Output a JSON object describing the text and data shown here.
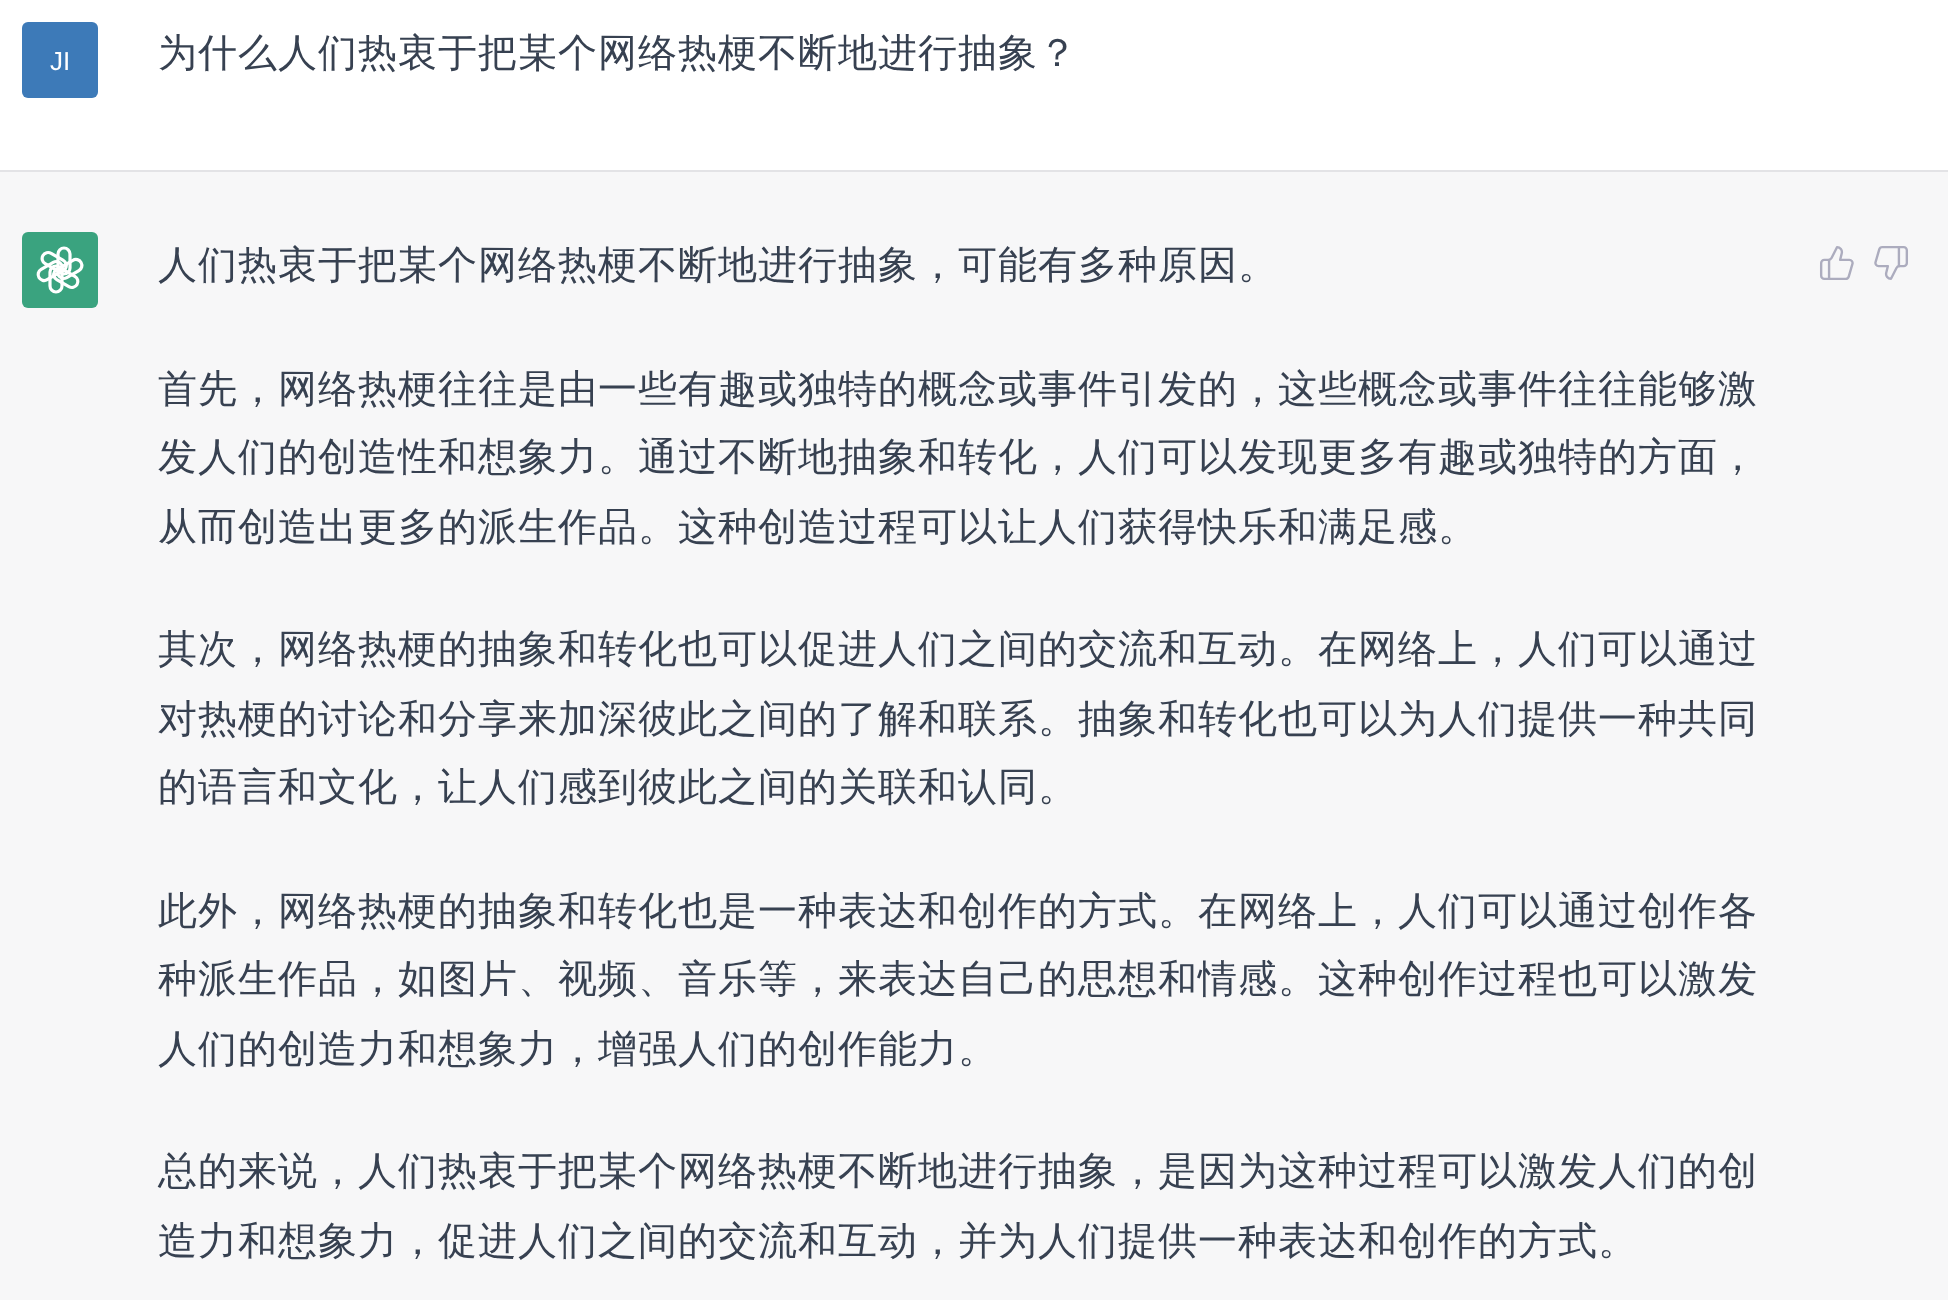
{
  "messages": [
    {
      "kind": "user",
      "avatar": "JI",
      "paragraphs": [
        "为什么人们热衷于把某个网络热梗不断地进行抽象？"
      ]
    },
    {
      "kind": "assistant",
      "paragraphs": [
        "人们热衷于把某个网络热梗不断地进行抽象，可能有多种原因。",
        "首先，网络热梗往往是由一些有趣或独特的概念或事件引发的，这些概念或事件往往能够激发人们的创造性和想象力。通过不断地抽象和转化，人们可以发现更多有趣或独特的方面，从而创造出更多的派生作品。这种创造过程可以让人们获得快乐和满足感。",
        "其次，网络热梗的抽象和转化也可以促进人们之间的交流和互动。在网络上，人们可以通过对热梗的讨论和分享来加深彼此之间的了解和联系。抽象和转化也可以为人们提供一种共同的语言和文化，让人们感到彼此之间的关联和认同。",
        "此外，网络热梗的抽象和转化也是一种表达和创作的方式。在网络上，人们可以通过创作各种派生作品，如图片、视频、音乐等，来表达自己的思想和情感。这种创作过程也可以激发人们的创造力和想象力，增强人们的创作能力。",
        "总的来说，人们热衷于把某个网络热梗不断地进行抽象，是因为这种过程可以激发人们的创造力和想象力，促进人们之间的交流和互动，并为人们提供一种表达和创作的方式。"
      ]
    }
  ]
}
